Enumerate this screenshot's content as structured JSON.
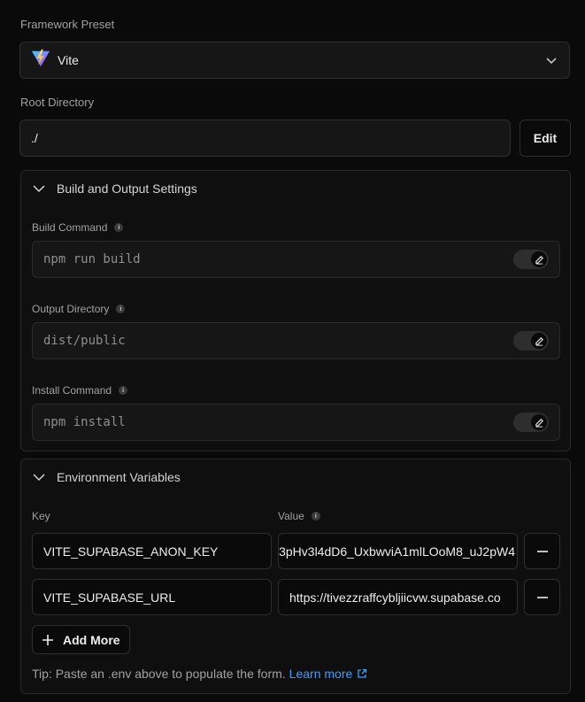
{
  "framework": {
    "label": "Framework Preset",
    "selected": "Vite",
    "icon": "vite-logo-icon"
  },
  "root": {
    "label": "Root Directory",
    "value": "./",
    "edit_label": "Edit"
  },
  "build_settings": {
    "title": "Build and Output Settings",
    "fields": [
      {
        "label": "Build Command",
        "placeholder": "npm run build"
      },
      {
        "label": "Output Directory",
        "placeholder": "dist/public"
      },
      {
        "label": "Install Command",
        "placeholder": "npm install"
      }
    ]
  },
  "env": {
    "title": "Environment Variables",
    "key_header": "Key",
    "value_header": "Value",
    "rows": [
      {
        "key": "VITE_SUPABASE_ANON_KEY",
        "value": "3pHv3l4dD6_UxbwviA1mlLOoM8_uJ2pW4"
      },
      {
        "key": "VITE_SUPABASE_URL",
        "value": "https://tivezzraffcybljiicvw.supabase.co"
      }
    ],
    "add_more_label": "Add More",
    "tip_text": "Tip: Paste an .env above to populate the form.",
    "learn_more_label": "Learn more"
  }
}
